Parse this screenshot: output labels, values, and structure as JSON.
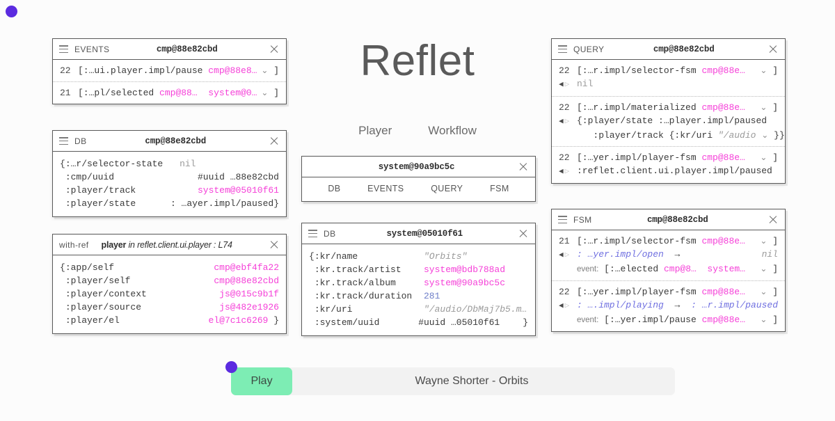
{
  "theme": {
    "background": "#fcfcfc",
    "accent_purple": "#5b2be0",
    "accent_green": "#7dedb4",
    "ref_pink": "#f540d8",
    "state_blue": "#6f6fe0",
    "number_blue": "#6f7fc9",
    "string_gray": "#9a9a9a",
    "panel_border": "#5a5a5a"
  },
  "hero": {
    "title": "Reflet",
    "nav": [
      {
        "label": "Player"
      },
      {
        "label": "Workflow"
      }
    ]
  },
  "panels": {
    "events_left": {
      "kind": "EVENTS",
      "title": "cmp@88e82cbd",
      "close": "×",
      "rows": [
        {
          "num": "22",
          "open": "[:",
          "name": "…ui.player.impl/pause",
          "args": [
            {
              "text": "cmp@88e8…",
              "color": "pink"
            }
          ],
          "chevron": "⌄",
          "close_bracket": "]"
        },
        {
          "num": "21",
          "open": "[:",
          "name": "…pl/selected",
          "args": [
            {
              "text": "cmp@88…",
              "color": "pink"
            },
            {
              "text": "system@0…",
              "color": "pink"
            }
          ],
          "chevron": "⌄",
          "close_bracket": "]"
        }
      ]
    },
    "db_left": {
      "kind": "DB",
      "title": "cmp@88e82cbd",
      "close": "×",
      "open_brace": "{",
      "close_brace": "}",
      "entries": [
        {
          "key": ":…r/selector-state",
          "value": "nil",
          "value_style": "gray",
          "inline": true
        },
        {
          "key": ":cmp/uuid",
          "value": "#uuid …88e82cbd",
          "value_style": "kw"
        },
        {
          "key": ":player/track",
          "value": "system@05010f61",
          "value_style": "pink"
        },
        {
          "key": ":player/state",
          "value": ": …ayer.impl/paused",
          "value_style": "kw"
        }
      ]
    },
    "with_ref": {
      "kind": "with-ref",
      "ref_name": "player",
      "ref_in": "in",
      "ref_location": "reflet.client.ui.player : L74",
      "close": "×",
      "open_brace": "{",
      "close_brace": "}",
      "entries": [
        {
          "key": ":app/self",
          "value": "cmp@ebf4fa22",
          "value_style": "pink"
        },
        {
          "key": ":player/self",
          "value": "cmp@88e82cbd",
          "value_style": "pink"
        },
        {
          "key": ":player/context",
          "value": "js@015c9b1f",
          "value_style": "pink"
        },
        {
          "key": ":player/source",
          "value": "js@482e1926",
          "value_style": "pink"
        },
        {
          "key": ":player/el",
          "value": "el@7c1c6269",
          "value_style": "pink"
        }
      ]
    },
    "system_tabs": {
      "title": "system@90a9bc5c",
      "close": "×",
      "tabs": [
        {
          "label": "DB"
        },
        {
          "label": "EVENTS"
        },
        {
          "label": "QUERY"
        },
        {
          "label": "FSM"
        }
      ]
    },
    "db_center": {
      "kind": "DB",
      "title": "system@05010f61",
      "close": "×",
      "open_brace": "{",
      "close_brace": "}",
      "entries": [
        {
          "key": ":kr/name",
          "value": "\"Orbits\"",
          "value_style": "strv"
        },
        {
          "key": ":kr.track/artist",
          "value": "system@bdb788ad",
          "value_style": "pink"
        },
        {
          "key": ":kr.track/album",
          "value": "system@90a9bc5c",
          "value_style": "pink"
        },
        {
          "key": ":kr.track/duration",
          "value": "281",
          "value_style": "blueno"
        },
        {
          "key": ":kr/uri",
          "value": "\"/audio/DbMaj7b5.m…",
          "value_style": "strv"
        },
        {
          "key": ":system/uuid",
          "value": "#uuid …05010f61",
          "value_style": "kw"
        }
      ]
    },
    "query_right": {
      "kind": "QUERY",
      "title": "cmp@88e82cbd",
      "close": "×",
      "rows": [
        {
          "num": "22",
          "open": "[:",
          "name": "…r.impl/selector-fsm",
          "args": [
            {
              "text": "cmp@88e…",
              "color": "pink"
            }
          ],
          "chevron": "⌄",
          "close_bracket": "]",
          "detail": [
            {
              "arrows": true,
              "text": "nil",
              "style": "gray"
            }
          ]
        },
        {
          "num": "22",
          "open": "[:",
          "name": "…r.impl/materialized",
          "args": [
            {
              "text": "cmp@88e…",
              "color": "pink"
            }
          ],
          "chevron": "⌄",
          "close_bracket": "]",
          "detail": [
            {
              "arrows": true,
              "text": "{:player/state :…player.impl/paused",
              "style": "kw"
            },
            {
              "arrows": false,
              "text": "   :player/track {:kr/uri ",
              "style": "kw",
              "tail_string": "\"/audio",
              "tail_chevron": "⌄",
              "tail_close": "}}"
            }
          ]
        },
        {
          "num": "22",
          "open": "[:",
          "name": "…yer.impl/player-fsm",
          "args": [
            {
              "text": "cmp@88e…",
              "color": "pink"
            }
          ],
          "chevron": "⌄",
          "close_bracket": "]",
          "detail": [
            {
              "arrows": true,
              "text": ":reflet.client.ui.player.impl/paused",
              "style": "kw"
            }
          ]
        }
      ]
    },
    "fsm_right": {
      "kind": "FSM",
      "title": "cmp@88e82cbd",
      "close": "×",
      "rows": [
        {
          "num": "21",
          "open": "[:",
          "name": "…r.impl/selector-fsm",
          "args": [
            {
              "text": "cmp@88e…",
              "color": "pink"
            }
          ],
          "chevron": "⌄",
          "close_bracket": "]",
          "transition": {
            "from": ": …yer.impl/open",
            "arrow": "→",
            "to": "nil",
            "to_style": "ital-gray"
          },
          "event": {
            "label": "event:",
            "open": "[:",
            "name": "…elected",
            "args": [
              {
                "text": "cmp@8…",
                "color": "pink"
              },
              {
                "text": "system…",
                "color": "pink"
              }
            ],
            "chevron": "⌄",
            "close_bracket": "]"
          }
        },
        {
          "num": "22",
          "open": "[:",
          "name": "…yer.impl/player-fsm",
          "args": [
            {
              "text": "cmp@88e…",
              "color": "pink"
            }
          ],
          "chevron": "⌄",
          "close_bracket": "]",
          "transition": {
            "from": ": ….impl/playing",
            "arrow": "→",
            "to": ": …r.impl/paused",
            "to_style": "ital-blue"
          },
          "event": {
            "label": "event:",
            "open": "[:",
            "name": "…yer.impl/pause",
            "args": [
              {
                "text": "cmp@88e…",
                "color": "pink"
              }
            ],
            "chevron": "⌄",
            "close_bracket": "]"
          }
        }
      ]
    }
  },
  "player_bar": {
    "play_label": "Play",
    "now_playing": "Wayne Shorter - Orbits"
  }
}
